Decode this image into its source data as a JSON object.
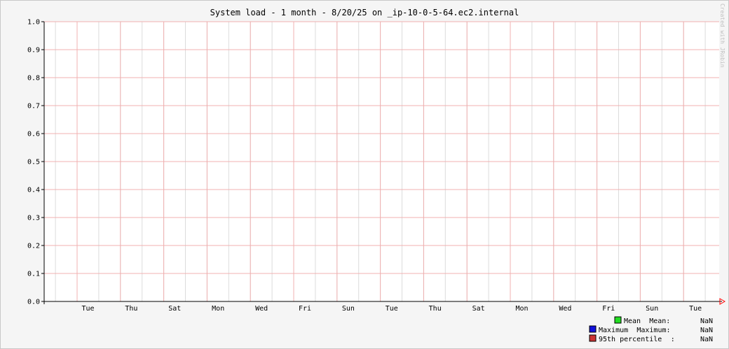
{
  "chart_data": {
    "type": "line",
    "title": "System load - 1 month - 8/20/25 on _ip-10-0-5-64.ec2.internal",
    "watermark": "Created with JRobin",
    "xlabel": "",
    "ylabel": "",
    "ylim": [
      0,
      1.0
    ],
    "y_ticks": [
      "0.0",
      "0.1",
      "0.2",
      "0.3",
      "0.4",
      "0.5",
      "0.6",
      "0.7",
      "0.8",
      "0.9",
      "1.0"
    ],
    "x_ticks": [
      "Tue",
      "Thu",
      "Sat",
      "Mon",
      "Wed",
      "Fri",
      "Sun",
      "Tue",
      "Thu",
      "Sat",
      "Mon",
      "Wed",
      "Fri",
      "Sun",
      "Tue"
    ],
    "grid": true,
    "series": [
      {
        "name": "Mean",
        "color": "#00e000",
        "values": []
      },
      {
        "name": "Maximum",
        "color": "#0000e0",
        "values": []
      },
      {
        "name": "95th percentile",
        "color": "#d04040",
        "values": []
      }
    ],
    "legend": [
      {
        "name": "Mean",
        "stat_label": "Mean:",
        "value": "NaN",
        "color": "#22dd22"
      },
      {
        "name": "Maximum",
        "stat_label": "Maximum:",
        "value": "NaN",
        "color": "#1111dd"
      },
      {
        "name": "95th percentile",
        "stat_label": ":",
        "value": "NaN",
        "color": "#cc3333"
      }
    ],
    "legend_position": "bottom-right",
    "colors": {
      "grid_major": "#f0b0b0",
      "grid_minor": "#dcdcdc",
      "axis": "#000000",
      "arrow": "#ff0000",
      "plot_bg": "#ffffff"
    }
  }
}
